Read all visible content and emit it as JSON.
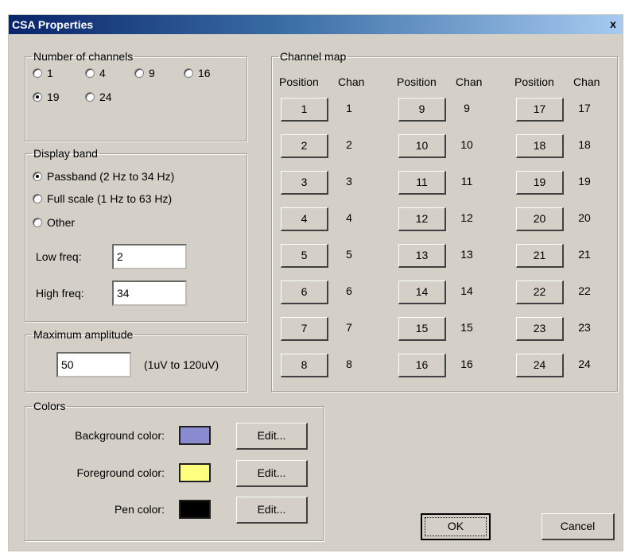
{
  "window": {
    "title": "CSA Properties",
    "close_glyph": "x"
  },
  "channels_group": {
    "legend": "Number of channels",
    "options": [
      "1",
      "4",
      "9",
      "16",
      "19",
      "24"
    ],
    "selected": "19"
  },
  "display_band": {
    "legend": "Display band",
    "options": [
      "Passband (2 Hz to 34 Hz)",
      "Full scale (1 Hz to 63 Hz)",
      "Other"
    ],
    "selected": "Passband (2 Hz to 34 Hz)",
    "low_label": "Low freq:",
    "low_value": "2",
    "high_label": "High freq:",
    "high_value": "34"
  },
  "max_amplitude": {
    "legend": "Maximum amplitude",
    "value": "50",
    "range": "(1uV to 120uV)"
  },
  "channel_map": {
    "legend": "Channel map",
    "position_header": "Position",
    "chan_header": "Chan",
    "columns": [
      [
        {
          "pos": "1",
          "chan": "1"
        },
        {
          "pos": "2",
          "chan": "2"
        },
        {
          "pos": "3",
          "chan": "3"
        },
        {
          "pos": "4",
          "chan": "4"
        },
        {
          "pos": "5",
          "chan": "5"
        },
        {
          "pos": "6",
          "chan": "6"
        },
        {
          "pos": "7",
          "chan": "7"
        },
        {
          "pos": "8",
          "chan": "8"
        }
      ],
      [
        {
          "pos": "9",
          "chan": "9"
        },
        {
          "pos": "10",
          "chan": "10"
        },
        {
          "pos": "11",
          "chan": "11"
        },
        {
          "pos": "12",
          "chan": "12"
        },
        {
          "pos": "13",
          "chan": "13"
        },
        {
          "pos": "14",
          "chan": "14"
        },
        {
          "pos": "15",
          "chan": "15"
        },
        {
          "pos": "16",
          "chan": "16"
        }
      ],
      [
        {
          "pos": "17",
          "chan": "17"
        },
        {
          "pos": "18",
          "chan": "18"
        },
        {
          "pos": "19",
          "chan": "19"
        },
        {
          "pos": "20",
          "chan": "20"
        },
        {
          "pos": "21",
          "chan": "21"
        },
        {
          "pos": "22",
          "chan": "22"
        },
        {
          "pos": "23",
          "chan": "23"
        },
        {
          "pos": "24",
          "chan": "24"
        }
      ]
    ]
  },
  "colors": {
    "legend": "Colors",
    "rows": [
      {
        "label": "Background color:",
        "color": "#8a8ad0",
        "edit": "Edit..."
      },
      {
        "label": "Foreground color:",
        "color": "#ffff80",
        "edit": "Edit..."
      },
      {
        "label": "Pen color:",
        "color": "#000000",
        "edit": "Edit..."
      }
    ]
  },
  "buttons": {
    "ok": "OK",
    "cancel": "Cancel"
  }
}
